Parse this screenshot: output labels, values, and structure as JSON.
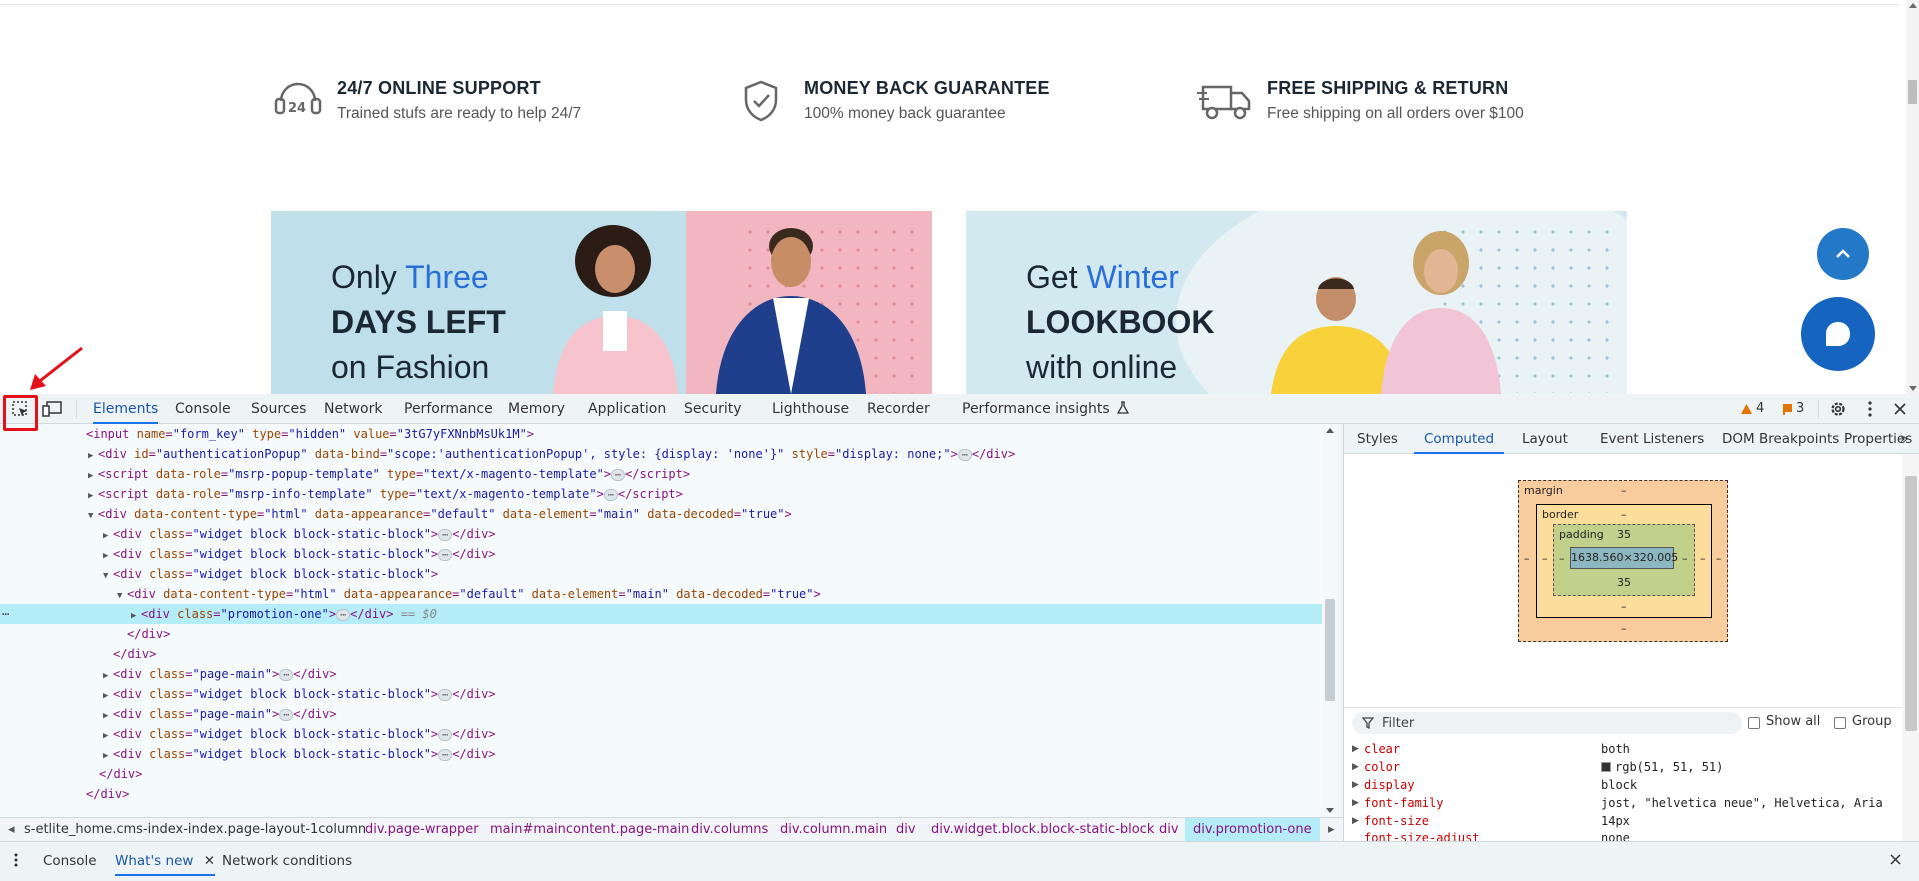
{
  "site": {
    "features": [
      {
        "title": "24/7 ONLINE SUPPORT",
        "sub": "Trained stufs are ready to help 24/7",
        "icon": "support-24-icon"
      },
      {
        "title": "MONEY BACK GUARANTEE",
        "sub": "100% money back guarantee",
        "icon": "shield-check-icon"
      },
      {
        "title": "FREE SHIPPING & RETURN",
        "sub": "Free shipping on all orders over $100",
        "icon": "truck-icon"
      }
    ],
    "banners": [
      {
        "pre": "Only ",
        "accent": "Three",
        "line2": "DAYS LEFT",
        "line3": "on Fashion"
      },
      {
        "pre": "Get ",
        "accent": "Winter",
        "line2": "LOOKBOOK",
        "line3": "with online"
      }
    ],
    "colors": {
      "accent": "#2a6fd6",
      "brand_blue": "#1565c0"
    }
  },
  "devtools": {
    "tabs": [
      "Elements",
      "Console",
      "Sources",
      "Network",
      "Performance",
      "Memory",
      "Application",
      "Security",
      "Lighthouse",
      "Recorder",
      "Performance insights"
    ],
    "active_tab": "Elements",
    "warnings": "4",
    "issues": "3",
    "dom_lines": [
      {
        "text_parts": [
          "<input",
          " name=",
          "\"form_key\"",
          " type=",
          "\"hidden\"",
          " value=",
          "\"3tG7yFXNnbMsUk1M\"",
          ">"
        ]
      },
      {
        "raw": "<div id=\"authenticationPopup\" data-bind=\"scope:'authenticationPopup', style: {display: 'none'}\" style=\"display: none;\">"
      },
      {
        "raw": "<script data-role=\"msrp-popup-template\" type=\"text/x-magento-template\">"
      },
      {
        "raw": "<script data-role=\"msrp-info-template\" type=\"text/x-magento-template\">"
      },
      {
        "raw": "<div data-content-type=\"html\" data-appearance=\"default\" data-element=\"main\" data-decoded=\"true\">"
      },
      {
        "raw": "<div class=\"widget block block-static-block\">"
      },
      {
        "raw": "<div class=\"widget block block-static-block\">"
      },
      {
        "raw": "<div class=\"widget block block-static-block\">"
      },
      {
        "raw": "<div data-content-type=\"html\" data-appearance=\"default\" data-element=\"main\" data-decoded=\"true\">"
      },
      {
        "raw": "<div class=\"promotion-one\">"
      },
      {
        "raw": "</div>"
      },
      {
        "raw": "</div>"
      },
      {
        "raw": "<div class=\"page-main\">"
      },
      {
        "raw": "<div class=\"widget block block-static-block\">"
      },
      {
        "raw": "<div class=\"page-main\">"
      },
      {
        "raw": "<div class=\"widget block block-static-block\">"
      },
      {
        "raw": "<div class=\"widget block block-static-block\">"
      },
      {
        "raw": "</div>"
      },
      {
        "raw": "</div>"
      }
    ],
    "selected_suffix": "== $0",
    "breadcrumbs": [
      "s-etlite_home.cms-index-index.page-layout-1column",
      "div.page-wrapper",
      "main#maincontent.page-main",
      "div.columns",
      "div.column.main",
      "div",
      "div.widget.block.block-static-block",
      "div",
      "div.promotion-one"
    ],
    "side_tabs": [
      "Styles",
      "Computed",
      "Layout",
      "Event Listeners",
      "DOM Breakpoints",
      "Properties"
    ],
    "active_side_tab": "Computed",
    "box_model": {
      "margin_label": "margin",
      "margin_val": "–",
      "border_label": "border",
      "border_val": "–",
      "padding_label": "padding",
      "padding_top": "35",
      "padding_bottom": "35",
      "content": "1638.560×320.005",
      "dash": "–"
    },
    "filter_placeholder": "Filter",
    "show_all": "Show all",
    "group": "Group",
    "computed": [
      {
        "name": "clear",
        "value": "both"
      },
      {
        "name": "color",
        "value": "rgb(51, 51, 51)"
      },
      {
        "name": "display",
        "value": "block"
      },
      {
        "name": "font-family",
        "value": "jost, \"helvetica neue\", Helvetica, Aria"
      },
      {
        "name": "font-size",
        "value": "14px"
      },
      {
        "name": "font-size-adjust",
        "value": "none"
      }
    ],
    "drawer_tabs": [
      "Console",
      "What's new",
      "Network conditions"
    ],
    "active_drawer_tab": "What's new"
  }
}
